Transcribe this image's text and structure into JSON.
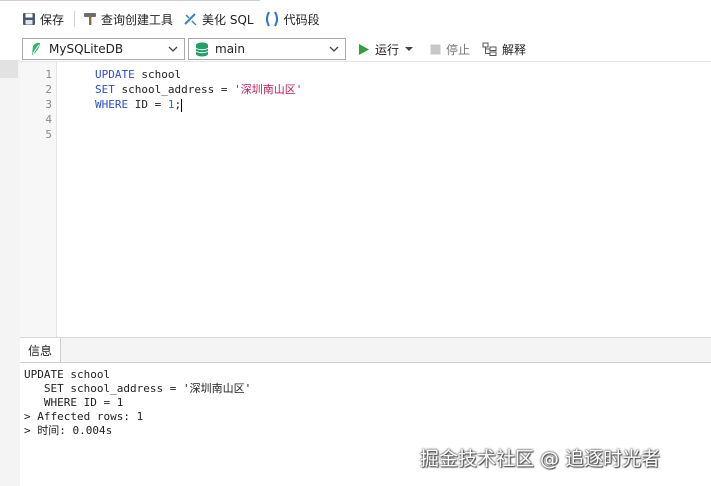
{
  "toolbar": {
    "save_label": "保存",
    "query_builder_label": "查询创建工具",
    "beautify_label": "美化 SQL",
    "snippet_label": "代码段"
  },
  "connection": {
    "database_value": "MySQLiteDB",
    "schema_value": "main"
  },
  "actions": {
    "run_label": "运行",
    "stop_label": "停止",
    "explain_label": "解释"
  },
  "editor": {
    "line_numbers": [
      "1",
      "2",
      "3",
      "4",
      "5"
    ],
    "lines": [
      {
        "kw": "UPDATE",
        "rest": " school"
      },
      {
        "kw": "SET",
        "rest": " school_address = ",
        "str": "'深圳南山区'"
      },
      {
        "kw": "WHERE",
        "rest": " ID = ",
        "num": "1",
        "tail": ";"
      }
    ]
  },
  "output_panel": {
    "tab_label": "信息",
    "lines": [
      "UPDATE school",
      "   SET school_address = '深圳南山区'",
      "   WHERE ID = 1",
      "> Affected rows: 1",
      "> 时间: 0.004s"
    ]
  },
  "watermark": "掘金技术社区 @ 追逐时光者",
  "colors": {
    "keyword": "#2a4fd3",
    "string": "#c2185b",
    "number": "#1b6fd8",
    "run_green": "#2ea043",
    "db_icon_green": "#22a06b"
  }
}
